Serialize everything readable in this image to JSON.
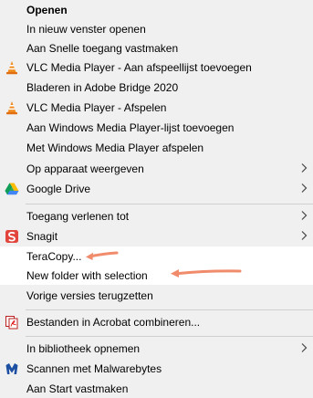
{
  "menu": {
    "items": [
      {
        "label": "Openen"
      },
      {
        "label": "In nieuw venster openen"
      },
      {
        "label": "Aan Snelle toegang vastmaken"
      },
      {
        "label": "VLC Media Player - Aan afspeellijst toevoegen",
        "icon": "vlc-cone-icon"
      },
      {
        "label": "Bladeren in Adobe Bridge 2020"
      },
      {
        "label": "VLC Media Player - Afspelen",
        "icon": "vlc-cone-icon"
      },
      {
        "label": "Aan Windows Media Player-lijst toevoegen"
      },
      {
        "label": "Met Windows Media Player afspelen"
      },
      {
        "label": "Op apparaat weergeven",
        "submenu": true
      },
      {
        "label": "Google Drive",
        "icon": "google-drive-icon",
        "submenu": true
      },
      {
        "label": "Toegang verlenen tot",
        "submenu": true
      },
      {
        "label": "Snagit",
        "icon": "snagit-icon",
        "submenu": true
      },
      {
        "label": "TeraCopy..."
      },
      {
        "label": "New folder with selection"
      },
      {
        "label": "Vorige versies terugzetten"
      },
      {
        "label": "Bestanden in Acrobat combineren...",
        "icon": "acrobat-combine-icon"
      },
      {
        "label": "In bibliotheek opnemen",
        "submenu": true
      },
      {
        "label": "Scannen met Malwarebytes",
        "icon": "malwarebytes-icon"
      },
      {
        "label": "Aan Start vastmaken"
      }
    ]
  },
  "colors": {
    "annotation_arrow": "#f08b6b",
    "vlc_orange": "#f08a1c",
    "snagit_red": "#e2453b",
    "malwarebytes_blue": "#1d4fa3"
  }
}
